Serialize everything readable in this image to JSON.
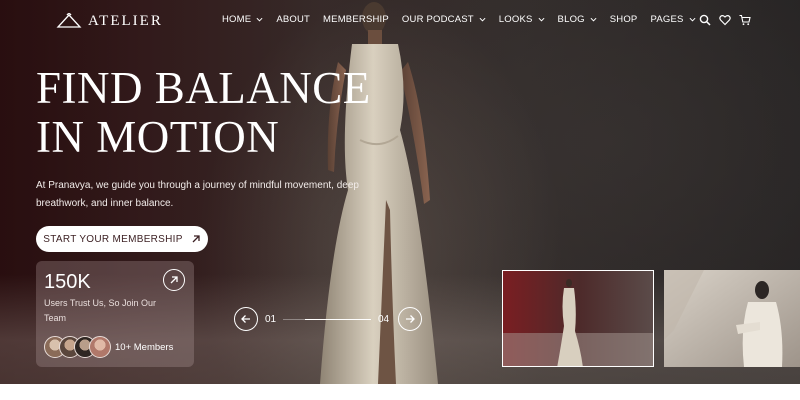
{
  "brand": {
    "name": "ATELIER",
    "logo_icon": "hanger-icon"
  },
  "nav": {
    "items": [
      {
        "label": "HOME",
        "dropdown": true
      },
      {
        "label": "ABOUT",
        "dropdown": false
      },
      {
        "label": "MEMBERSHIP",
        "dropdown": false
      },
      {
        "label": "OUR PODCAST",
        "dropdown": true
      },
      {
        "label": "LOOKS",
        "dropdown": true
      },
      {
        "label": "BLOG",
        "dropdown": true
      },
      {
        "label": "SHOP",
        "dropdown": false
      },
      {
        "label": "PAGES",
        "dropdown": true
      }
    ],
    "icons": [
      "search-icon",
      "heart-icon",
      "cart-icon"
    ]
  },
  "hero": {
    "title_line1": "FIND BALANCE",
    "title_line2": "IN MOTION",
    "description": "At Pranavya, we guide you through a journey of mindful movement, deep breathwork, and inner balance.",
    "cta_label": "START YOUR MEMBERSHIP"
  },
  "stats": {
    "value": "150K",
    "description": "Users Trust Us, So Join Our Team",
    "members_label": "10+ Members"
  },
  "slider": {
    "current": "01",
    "total": "04",
    "progress": 0.75
  },
  "colors": {
    "accent": "#3b1f22",
    "hero_dark": "#2a1616",
    "white": "#ffffff"
  }
}
